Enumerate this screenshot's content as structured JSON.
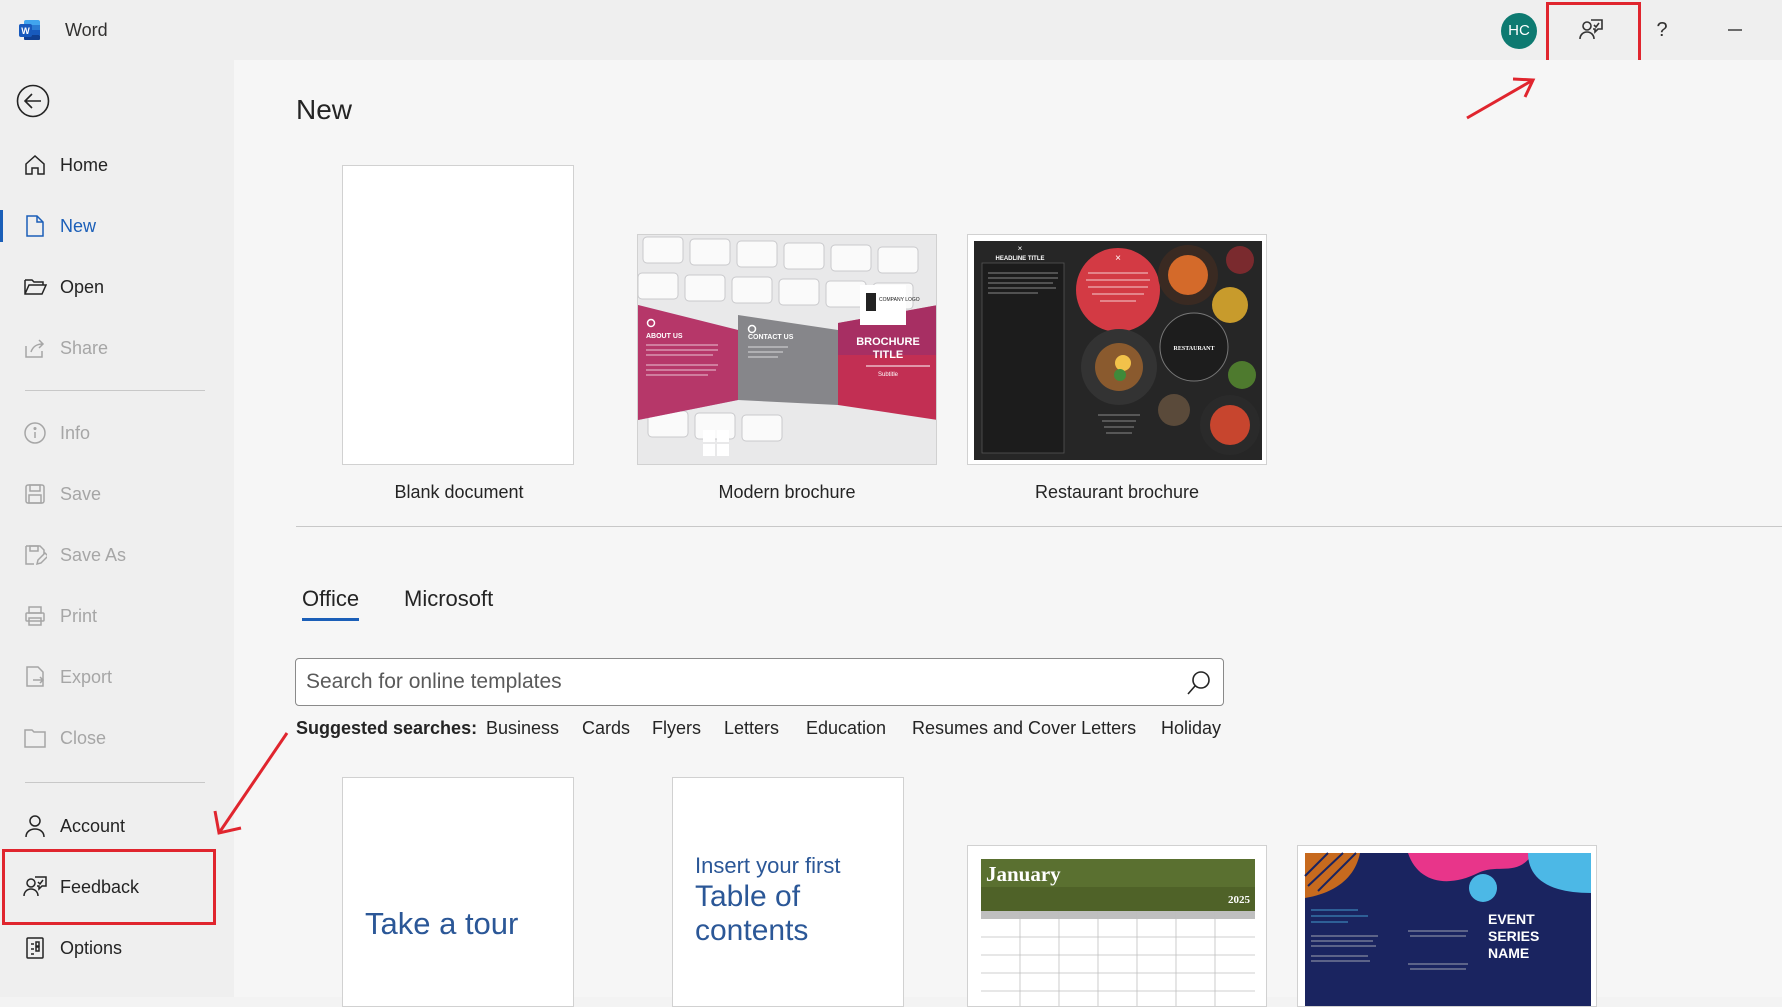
{
  "app": {
    "name": "Word",
    "avatar_initials": "HC",
    "help_label": "?"
  },
  "sidebar": {
    "items": [
      {
        "label": "Home"
      },
      {
        "label": "New"
      },
      {
        "label": "Open"
      },
      {
        "label": "Share"
      },
      {
        "label": "Info"
      },
      {
        "label": "Save"
      },
      {
        "label": "Save As"
      },
      {
        "label": "Print"
      },
      {
        "label": "Export"
      },
      {
        "label": "Close"
      },
      {
        "label": "Account"
      },
      {
        "label": "Feedback"
      },
      {
        "label": "Options"
      }
    ]
  },
  "main": {
    "title": "New",
    "featured": [
      {
        "label": "Blank document"
      },
      {
        "label": "Modern brochure"
      },
      {
        "label": "Restaurant brochure"
      }
    ],
    "tabs": [
      {
        "label": "Office"
      },
      {
        "label": "Microsoft"
      }
    ],
    "search": {
      "placeholder": "Search for online templates"
    },
    "suggested": {
      "label": "Suggested searches:",
      "links": [
        "Business",
        "Cards",
        "Flyers",
        "Letters",
        "Education",
        "Resumes and Cover Letters",
        "Holiday"
      ]
    },
    "gallery": {
      "tour_text": "Take a tour",
      "toc_text": [
        "Insert your first",
        "Table of",
        "contents"
      ],
      "calendar_month": "January",
      "calendar_year": "2025",
      "event_title": [
        "EVENT",
        "SERIES",
        "NAME"
      ]
    },
    "modern_brochure": {
      "about": "ABOUT US",
      "contact": "CONTACT US",
      "title": [
        "BROCHURE",
        "TITLE"
      ],
      "subtitle": "Subtitle",
      "logo": "COMPANY LOGO"
    },
    "restaurant_brochure": {
      "headline": "HEADLINE TITLE",
      "quote": "\"PUT A QUOTE HERE TO HIGHLIGHT THIS ISSUE OF YOUR NEWSLETTER.\"",
      "badge": "RESTAURANT"
    }
  },
  "colors": {
    "accent": "#1b5fb8",
    "highlight": "#e0252e",
    "avatar_bg": "#0e7a71"
  }
}
